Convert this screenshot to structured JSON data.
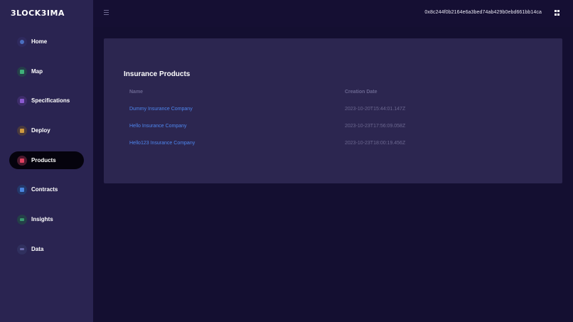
{
  "app": {
    "logo": "3LOCK3IMA"
  },
  "sidebar": {
    "items": [
      {
        "label": "Home",
        "icon": "home-icon",
        "color": "#3b5a9a"
      },
      {
        "label": "Map",
        "icon": "map-icon",
        "color": "#2f8a5a"
      },
      {
        "label": "Specifications",
        "icon": "specifications-icon",
        "color": "#7a4fb8"
      },
      {
        "label": "Deploy",
        "icon": "deploy-icon",
        "color": "#c08a3a"
      },
      {
        "label": "Products",
        "icon": "products-icon",
        "color": "#d23a5a",
        "active": true
      },
      {
        "label": "Contracts",
        "icon": "contracts-icon",
        "color": "#3f7ad8"
      },
      {
        "label": "Insights",
        "icon": "insights-icon",
        "color": "#3a8a6a"
      },
      {
        "label": "Data",
        "icon": "data-icon",
        "color": "#5a5a9a"
      }
    ]
  },
  "header": {
    "wallet_address": "0x8c244f0b2164e6a3bed74ab429b0ebd661bb14ca"
  },
  "main": {
    "title": "Insurance Products",
    "columns": [
      "Name",
      "Creation Date"
    ],
    "rows": [
      {
        "name": "Dummy Insurance Company",
        "date": "2023-10-20T15:44:01.147Z"
      },
      {
        "name": "Hello Insurance Company",
        "date": "2023-10-23T17:56:09.058Z"
      },
      {
        "name": "Hello123 Insurance Company",
        "date": "2023-10-23T18:00:19.456Z"
      }
    ]
  },
  "colors": {
    "background": "#140f31",
    "sidebar": "#2a2451",
    "card": "#2c2650",
    "link": "#4e86ee",
    "active_item": "#05030d"
  }
}
